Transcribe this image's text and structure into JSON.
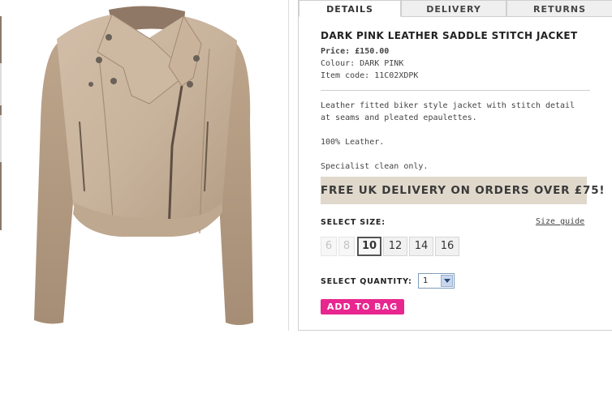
{
  "tabs": [
    {
      "label": "DETAILS",
      "active": true
    },
    {
      "label": "DELIVERY",
      "active": false
    },
    {
      "label": "RETURNS",
      "active": false
    }
  ],
  "product": {
    "title": "DARK PINK LEATHER SADDLE STITCH JACKET",
    "price_label": "Price:",
    "price": "£150.00",
    "colour_line": "Colour: DARK PINK",
    "item_code_line": "Item code: 11C02XDPK",
    "description": [
      "Leather fitted biker style jacket with stitch detail at seams and pleated epaulettes.",
      "100% Leather.",
      "Specialist clean only."
    ],
    "image_color": "#c8b39c"
  },
  "delivery_banner": "FREE UK DELIVERY ON ORDERS OVER £75!",
  "size": {
    "label": "SELECT SIZE:",
    "guide_link": "Size guide",
    "options": [
      {
        "label": "6",
        "available": false
      },
      {
        "label": "8",
        "available": false
      },
      {
        "label": "10",
        "available": true,
        "selected": true
      },
      {
        "label": "12",
        "available": true
      },
      {
        "label": "14",
        "available": true
      },
      {
        "label": "16",
        "available": true
      }
    ]
  },
  "quantity": {
    "label": "SELECT QUANTITY:",
    "value": "1"
  },
  "add_to_bag_label": "ADD TO BAG",
  "colors": {
    "accent_pink": "#e8268f",
    "banner_bg": "#e0d8cb"
  }
}
